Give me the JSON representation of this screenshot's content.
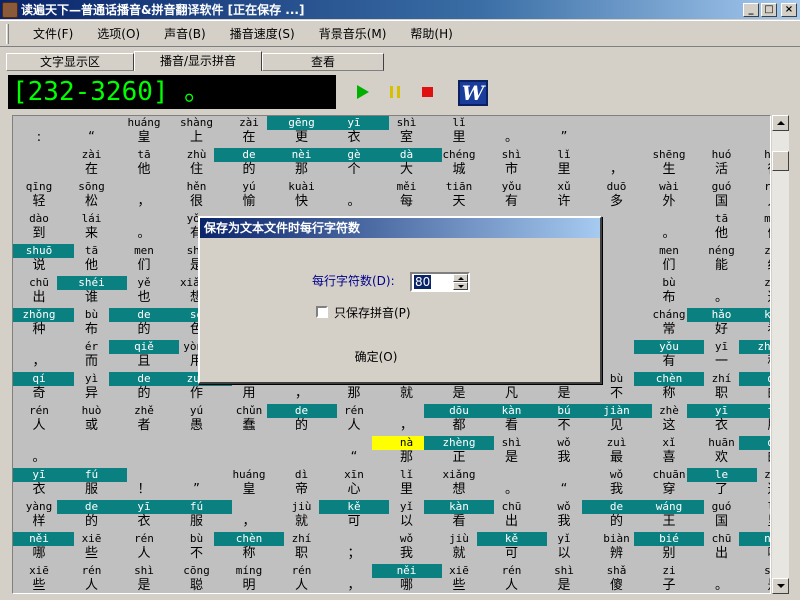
{
  "window": {
    "title": "读遍天下—普通话播音&拼音翻译软件 [正在保存 ...]",
    "min": "_",
    "max": "□",
    "close": "×"
  },
  "menu": [
    "文件(F)",
    "选项(O)",
    "声音(B)",
    "播音速度(S)",
    "背景音乐(M)",
    "帮助(H)"
  ],
  "tabs": [
    "文字显示区",
    "播音/显示拼音",
    "查看"
  ],
  "lcd_text": "[232-3260] 。",
  "word_label": "W",
  "colors": {
    "highlight": "#0a8080",
    "current": "#ffff00",
    "lcd": "#00ff00"
  },
  "dialog": {
    "title": "保存为文本文件时每行字符数",
    "chars_label": "每行字符数(D):",
    "chars_value": "80",
    "pinyin_only_label": "只保存拼音(P)",
    "pinyin_only_checked": false,
    "ok_label": "确定(O)"
  },
  "grid_rows": [
    [
      [
        "",
        ":",
        ""
      ],
      [
        "",
        "“",
        ""
      ],
      [
        "huáng",
        "皇",
        ""
      ],
      [
        "shàng",
        "上",
        ""
      ],
      [
        "zài",
        "在",
        ""
      ],
      [
        "gēng",
        "更",
        "t"
      ],
      [
        "yī",
        "衣",
        "t"
      ],
      [
        "shì",
        "室",
        ""
      ],
      [
        "lǐ",
        "里",
        ""
      ],
      [
        "",
        "。",
        ""
      ],
      [
        "",
        "”",
        ""
      ]
    ],
    [
      [
        "",
        ""
      ],
      [
        "zài",
        "在",
        ""
      ],
      [
        "tā",
        "他",
        ""
      ],
      [
        "zhù",
        "住",
        ""
      ],
      [
        "de",
        "的",
        "t"
      ],
      [
        "nèi",
        "那",
        "t"
      ],
      [
        "gè",
        "个",
        "t"
      ],
      [
        "dà",
        "大",
        "t"
      ],
      [
        "chéng",
        "城",
        ""
      ],
      [
        "shì",
        "市",
        ""
      ],
      [
        "lǐ",
        "里",
        ""
      ],
      [
        "",
        "，",
        ""
      ],
      [
        "shēng",
        "生",
        ""
      ],
      [
        "huó",
        "活",
        ""
      ],
      [
        "hěn",
        "很",
        ""
      ]
    ],
    [
      [
        "qīng",
        "轻",
        ""
      ],
      [
        "sōng",
        "松",
        ""
      ],
      [
        "",
        "，",
        ""
      ],
      [
        "hěn",
        "很",
        ""
      ],
      [
        "yú",
        "愉",
        ""
      ],
      [
        "kuài",
        "快",
        ""
      ],
      [
        "",
        "。",
        ""
      ],
      [
        "měi",
        "每",
        ""
      ],
      [
        "tiān",
        "天",
        ""
      ],
      [
        "yǒu",
        "有",
        ""
      ],
      [
        "xǔ",
        "许",
        ""
      ],
      [
        "duō",
        "多",
        ""
      ],
      [
        "wài",
        "外",
        ""
      ],
      [
        "guó",
        "国",
        ""
      ],
      [
        "rén",
        "人",
        ""
      ]
    ],
    [
      [
        "dào",
        "到",
        ""
      ],
      [
        "lái",
        "来",
        ""
      ],
      [
        "",
        "。",
        ""
      ],
      [
        "yǒu",
        "有",
        ""
      ],
      [
        "",
        "",
        ""
      ],
      [
        "",
        "",
        ""
      ],
      [
        "",
        "",
        ""
      ],
      [
        "",
        "",
        ""
      ],
      [
        "",
        "",
        ""
      ],
      [
        "",
        "",
        ""
      ],
      [
        "",
        "",
        ""
      ],
      [
        "",
        "",
        ""
      ],
      [
        "",
        "。",
        ""
      ],
      [
        "tā",
        "他",
        ""
      ],
      [
        "men",
        "们",
        ""
      ]
    ],
    [
      [
        "shuō",
        "说",
        "t"
      ],
      [
        "tā",
        "他",
        ""
      ],
      [
        "men",
        "们",
        ""
      ],
      [
        "shì",
        "是",
        ""
      ],
      [
        "",
        "",
        ""
      ],
      [
        "",
        "",
        ""
      ],
      [
        "",
        "",
        ""
      ],
      [
        "",
        "",
        ""
      ],
      [
        "",
        "",
        ""
      ],
      [
        "",
        "",
        ""
      ],
      [
        "",
        "",
        ""
      ],
      [
        "",
        "",
        ""
      ],
      [
        "men",
        "们",
        ""
      ],
      [
        "néng",
        "能",
        ""
      ],
      [
        "zhī",
        "织",
        ""
      ]
    ],
    [
      [
        "chū",
        "出",
        ""
      ],
      [
        "shéi",
        "谁",
        "t"
      ],
      [
        "yě",
        "也",
        ""
      ],
      [
        "xiǎng",
        "想",
        ""
      ],
      [
        "",
        "",
        ""
      ],
      [
        "",
        "",
        ""
      ],
      [
        "",
        "",
        ""
      ],
      [
        "",
        "",
        ""
      ],
      [
        "",
        "",
        ""
      ],
      [
        "",
        "",
        ""
      ],
      [
        "",
        "",
        ""
      ],
      [
        "",
        "",
        ""
      ],
      [
        "bù",
        "布",
        ""
      ],
      [
        "",
        "。",
        ""
      ],
      [
        "zhè",
        "这",
        ""
      ]
    ],
    [
      [
        "zhǒng",
        "种",
        "t"
      ],
      [
        "bù",
        "布",
        ""
      ],
      [
        "de",
        "的",
        "t"
      ],
      [
        "sè",
        "色",
        "t"
      ],
      [
        "",
        "",
        ""
      ],
      [
        "",
        "",
        ""
      ],
      [
        "",
        "",
        ""
      ],
      [
        "",
        "",
        ""
      ],
      [
        "",
        "",
        ""
      ],
      [
        "",
        "",
        ""
      ],
      [
        "",
        "",
        ""
      ],
      [
        "",
        "",
        ""
      ],
      [
        "cháng",
        "常",
        ""
      ],
      [
        "hǎo",
        "好",
        "t"
      ],
      [
        "kàn",
        "看",
        "t"
      ]
    ],
    [
      [
        "",
        "，",
        ""
      ],
      [
        "ér",
        "而",
        ""
      ],
      [
        "qiě",
        "且",
        "t"
      ],
      [
        "yòng",
        "用",
        ""
      ],
      [
        "",
        "",
        ""
      ],
      [
        "",
        "",
        ""
      ],
      [
        "",
        "",
        ""
      ],
      [
        "",
        "",
        ""
      ],
      [
        "",
        "",
        ""
      ],
      [
        "",
        "",
        ""
      ],
      [
        "",
        "",
        ""
      ],
      [
        "",
        "",
        ""
      ],
      [
        "yǒu",
        "有",
        "t"
      ],
      [
        "yī",
        "一",
        ""
      ],
      [
        "zhǒng",
        "种",
        "t"
      ]
    ],
    [
      [
        "qí",
        "奇",
        "t"
      ],
      [
        "yì",
        "异",
        ""
      ],
      [
        "de",
        "的",
        "t"
      ],
      [
        "zuò",
        "作",
        "t"
      ],
      [
        "yòng",
        "用",
        ""
      ],
      [
        "",
        "，",
        ""
      ],
      [
        "nà",
        "那",
        ""
      ],
      [
        "jiù",
        "就",
        ""
      ],
      [
        "shì",
        "是",
        ""
      ],
      [
        "fán",
        "凡",
        ""
      ],
      [
        "shì",
        "是",
        ""
      ],
      [
        "bù",
        "不",
        ""
      ],
      [
        "chèn",
        "称",
        "t"
      ],
      [
        "zhí",
        "职",
        ""
      ],
      [
        "de",
        "的",
        "t"
      ]
    ],
    [
      [
        "rén",
        "人",
        ""
      ],
      [
        "huò",
        "或",
        ""
      ],
      [
        "zhě",
        "者",
        ""
      ],
      [
        "yú",
        "愚",
        ""
      ],
      [
        "chǔn",
        "蠢",
        ""
      ],
      [
        "de",
        "的",
        "t"
      ],
      [
        "rén",
        "人",
        ""
      ],
      [
        "",
        "，",
        ""
      ],
      [
        "dōu",
        "都",
        "t"
      ],
      [
        "kàn",
        "看",
        "t"
      ],
      [
        "bú",
        "不",
        "t"
      ],
      [
        "jiàn",
        "见",
        "t"
      ],
      [
        "zhè",
        "这",
        ""
      ],
      [
        "yī",
        "衣",
        "t"
      ],
      [
        "fú",
        "服",
        "t"
      ]
    ],
    [
      [
        "",
        "。",
        ""
      ],
      [
        "",
        "",
        ""
      ],
      [
        "",
        "",
        ""
      ],
      [
        "",
        "",
        ""
      ],
      [
        "",
        "",
        ""
      ],
      [
        "",
        "",
        ""
      ],
      [
        "",
        "“",
        ""
      ],
      [
        "nà",
        "那",
        "y"
      ],
      [
        "zhèng",
        "正",
        "t"
      ],
      [
        "shì",
        "是",
        ""
      ],
      [
        "wǒ",
        "我",
        ""
      ],
      [
        "zuì",
        "最",
        ""
      ],
      [
        "xǐ",
        "喜",
        ""
      ],
      [
        "huān",
        "欢",
        ""
      ],
      [
        "de",
        "的",
        "t"
      ]
    ],
    [
      [
        "yī",
        "衣",
        "t"
      ],
      [
        "fú",
        "服",
        "t"
      ],
      [
        "",
        "！",
        ""
      ],
      [
        "",
        "”",
        ""
      ],
      [
        "huáng",
        "皇",
        ""
      ],
      [
        "dì",
        "帝",
        ""
      ],
      [
        "xīn",
        "心",
        ""
      ],
      [
        "lǐ",
        "里",
        ""
      ],
      [
        "xiǎng",
        "想",
        ""
      ],
      [
        "",
        "。",
        ""
      ],
      [
        "",
        "“",
        ""
      ],
      [
        "wǒ",
        "我",
        ""
      ],
      [
        "chuān",
        "穿",
        ""
      ],
      [
        "le",
        "了",
        "t"
      ],
      [
        "zhè",
        "这",
        ""
      ]
    ],
    [
      [
        "yàng",
        "样",
        ""
      ],
      [
        "de",
        "的",
        "t"
      ],
      [
        "yī",
        "衣",
        "t"
      ],
      [
        "fú",
        "服",
        "t"
      ],
      [
        "",
        "，",
        ""
      ],
      [
        "jiù",
        "就",
        ""
      ],
      [
        "kě",
        "可",
        "t"
      ],
      [
        "yǐ",
        "以",
        ""
      ],
      [
        "kàn",
        "看",
        "t"
      ],
      [
        "chū",
        "出",
        ""
      ],
      [
        "wǒ",
        "我",
        ""
      ],
      [
        "de",
        "的",
        "t"
      ],
      [
        "wáng",
        "王",
        "t"
      ],
      [
        "guó",
        "国",
        ""
      ],
      [
        "lǐ",
        "里",
        ""
      ]
    ],
    [
      [
        "něi",
        "哪",
        "t"
      ],
      [
        "xiē",
        "些",
        ""
      ],
      [
        "rén",
        "人",
        ""
      ],
      [
        "bù",
        "不",
        ""
      ],
      [
        "chèn",
        "称",
        "t"
      ],
      [
        "zhí",
        "职",
        ""
      ],
      [
        "",
        "；",
        ""
      ],
      [
        "wǒ",
        "我",
        ""
      ],
      [
        "jiù",
        "就",
        ""
      ],
      [
        "kě",
        "可",
        "t"
      ],
      [
        "yǐ",
        "以",
        ""
      ],
      [
        "biàn",
        "辨",
        ""
      ],
      [
        "bié",
        "别",
        "t"
      ],
      [
        "chū",
        "出",
        ""
      ],
      [
        "něi",
        "哪",
        "t"
      ]
    ],
    [
      [
        "xiē",
        "些",
        ""
      ],
      [
        "rén",
        "人",
        ""
      ],
      [
        "shì",
        "是",
        ""
      ],
      [
        "cōng",
        "聪",
        ""
      ],
      [
        "míng",
        "明",
        ""
      ],
      [
        "rén",
        "人",
        ""
      ],
      [
        "",
        "，",
        ""
      ],
      [
        "něi",
        "哪",
        "t"
      ],
      [
        "xiē",
        "些",
        ""
      ],
      [
        "rén",
        "人",
        ""
      ],
      [
        "shì",
        "是",
        ""
      ],
      [
        "shǎ",
        "傻",
        ""
      ],
      [
        "zi",
        "子",
        ""
      ],
      [
        "",
        "。",
        ""
      ],
      [
        "shì",
        "是",
        ""
      ]
    ]
  ]
}
